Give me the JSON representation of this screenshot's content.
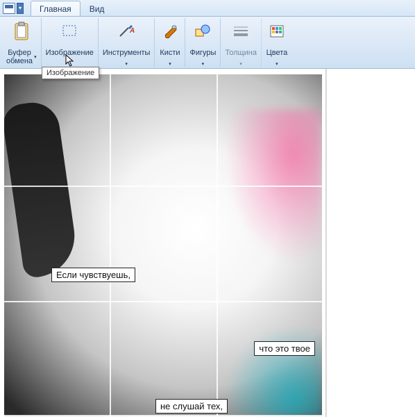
{
  "tabs": {
    "main": "Главная",
    "view": "Вид"
  },
  "ribbon": {
    "clipboard": "Буфер\nобмена",
    "image": "Изображение",
    "tools": "Инструменты",
    "brushes": "Кисти",
    "shapes": "Фигуры",
    "thickness": "Толщина",
    "colors": "Цвета"
  },
  "tooltip": "Изображение",
  "canvas_text": {
    "line1": "Если чувствуешь,",
    "line2": "что это твое",
    "line3": "не слушай тех,"
  }
}
